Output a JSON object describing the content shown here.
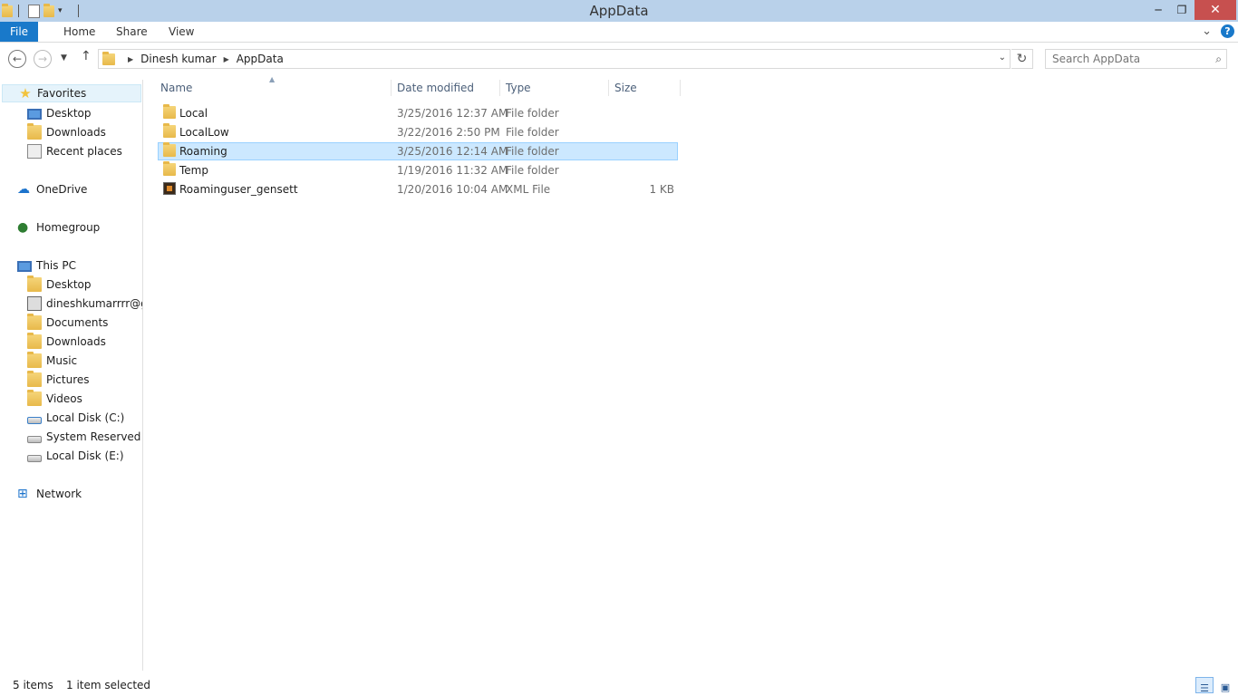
{
  "window": {
    "title": "AppData",
    "minimize": "─",
    "restore": "❐",
    "close": "✕"
  },
  "ribbon": {
    "tabs": [
      "File",
      "Home",
      "Share",
      "View"
    ],
    "expand_icon": "⌄",
    "help": "?"
  },
  "address": {
    "crumbs": [
      "Dinesh kumar",
      "AppData"
    ],
    "search_placeholder": "Search AppData"
  },
  "nav": {
    "favorites": "Favorites",
    "favorites_items": [
      "Desktop",
      "Downloads",
      "Recent places"
    ],
    "onedrive": "OneDrive",
    "homegroup": "Homegroup",
    "thispc": "This PC",
    "thispc_items": [
      "Desktop",
      "dineshkumarrrr@gm",
      "Documents",
      "Downloads",
      "Music",
      "Pictures",
      "Videos",
      "Local Disk (C:)",
      "System Reserved (D:",
      "Local Disk (E:)"
    ],
    "network": "Network"
  },
  "columns": {
    "name": "Name",
    "date": "Date modified",
    "type": "Type",
    "size": "Size"
  },
  "files": [
    {
      "name": "Local",
      "date": "3/25/2016 12:37 AM",
      "type": "File folder",
      "size": ""
    },
    {
      "name": "LocalLow",
      "date": "3/22/2016 2:50 PM",
      "type": "File folder",
      "size": ""
    },
    {
      "name": "Roaming",
      "date": "3/25/2016 12:14 AM",
      "type": "File folder",
      "size": ""
    },
    {
      "name": "Temp",
      "date": "1/19/2016 11:32 AM",
      "type": "File folder",
      "size": ""
    },
    {
      "name": "Roaminguser_gensett",
      "date": "1/20/2016 10:04 AM",
      "type": "XML File",
      "size": "1 KB"
    }
  ],
  "status": {
    "items": "5 items",
    "selected": "1 item selected"
  },
  "colors": {
    "titlebar": "#b9d1ea",
    "file_tab": "#1979ca",
    "selection": "#cce8ff",
    "close": "#c7504f"
  }
}
